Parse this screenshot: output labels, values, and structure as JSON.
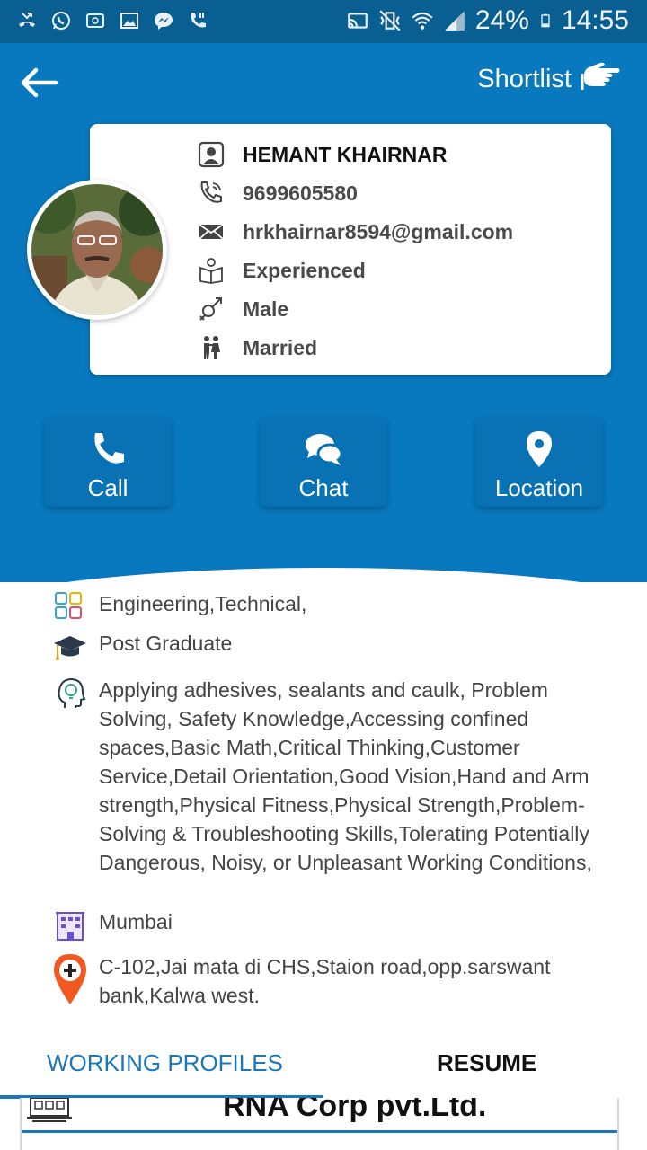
{
  "statusbar": {
    "battery": "24%",
    "time": "14:55",
    "left_icons": [
      "missed-call-icon",
      "whatsapp-icon",
      "screen-icon",
      "image-icon",
      "messenger-icon",
      "call-icon"
    ],
    "right_icons": [
      "cast-icon",
      "vibrate-icon",
      "wifi-icon",
      "signal-icon",
      "battery-icon"
    ]
  },
  "header": {
    "shortlist_label": "Shortlist"
  },
  "profile": {
    "name": "HEMANT KHAIRNAR",
    "phone": "9699605580",
    "email": "hrkhairnar8594@gmail.com",
    "experience": "Experienced",
    "gender": "Male",
    "marital_status": "Married"
  },
  "actions": {
    "call": "Call",
    "chat": "Chat",
    "location": "Location"
  },
  "details": {
    "category": "Engineering,Technical,",
    "education": "Post Graduate",
    "skills": " Applying adhesives, sealants and caulk, Problem Solving, Safety Knowledge,Accessing confined spaces,Basic Math,Critical Thinking,Customer Service,Detail Orientation,Good Vision,Hand and Arm strength,Physical Fitness,Physical Strength,Problem-Solving & Troubleshooting Skills,Tolerating Potentially Dangerous, Noisy, or Unpleasant Working Conditions,",
    "city": "Mumbai",
    "address": "C-102,Jai mata di CHS,Staion road,opp.sarswant bank,Kalwa west."
  },
  "tabs": [
    {
      "label": "WORKING PROFILES",
      "active": true
    },
    {
      "label": "RESUME",
      "active": false
    }
  ],
  "company": {
    "name": "RNA Corp pvt.Ltd."
  },
  "colors": {
    "primary": "#0879be",
    "statusbar": "#0a5f92",
    "accent": "#1b77b7",
    "pin": "#f05a22"
  }
}
